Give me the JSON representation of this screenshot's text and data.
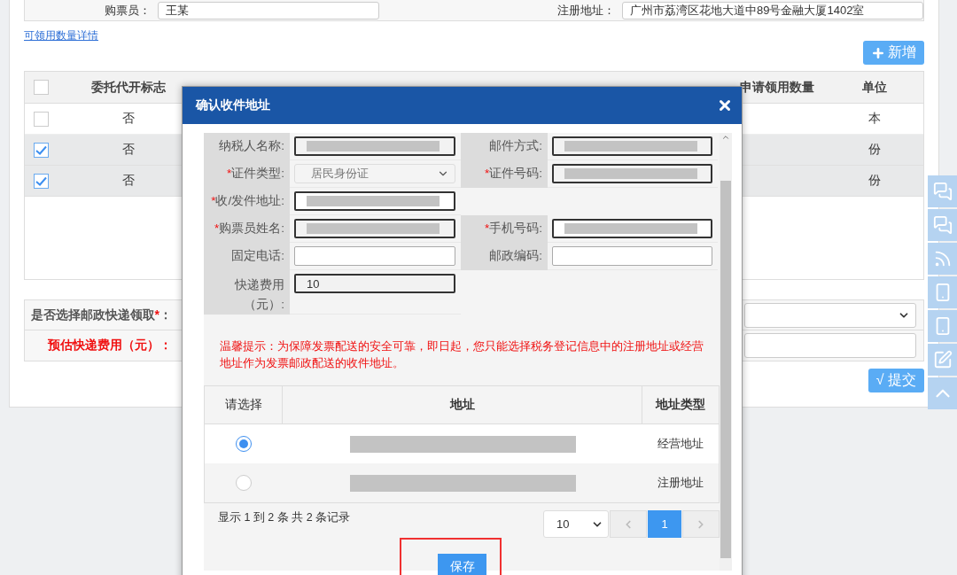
{
  "top_fields": [
    {
      "label": "购票员：",
      "value": "王某"
    },
    {
      "label": "注册地址：",
      "value": "广州市荔湾区花地大道中89号金融大厦1402室"
    }
  ],
  "detail_link": "可领用数量详情",
  "add_button": "新增",
  "table": {
    "header_checked": false,
    "columns": [
      "委托代开标志",
      "申请领用数量",
      "单位"
    ],
    "rows": [
      {
        "checked": false,
        "selected": false,
        "agent": "否",
        "unit": "本"
      },
      {
        "checked": true,
        "selected": true,
        "agent": "否",
        "unit": "份"
      },
      {
        "checked": true,
        "selected": true,
        "agent": "否",
        "unit": "份"
      }
    ]
  },
  "pickup_form": [
    {
      "label": "是否选择邮政快递领取",
      "asterisk": "*",
      "suffix": "：",
      "kind": "select",
      "highlight": false
    },
    {
      "label": "预估快递费用（元）",
      "suffix": "：",
      "kind": "input",
      "highlight": true
    }
  ],
  "submit_button": "√ 提交",
  "side_tools": [
    {
      "kind": "chat"
    },
    {
      "kind": "chat"
    },
    {
      "kind": "social"
    },
    {
      "kind": "phone"
    },
    {
      "kind": "phone"
    },
    {
      "kind": "edit"
    },
    {
      "kind": "top"
    }
  ],
  "dialog": {
    "title": "确认收件地址",
    "rows": [
      [
        {
          "label": "纳税人名称:",
          "kind": "input",
          "redacted": true,
          "editable": false,
          "multiline": false
        },
        {
          "label": "邮件方式:",
          "kind": "input",
          "redacted": true,
          "editable": false,
          "multiline": false
        }
      ],
      [
        {
          "asterisk": "*",
          "label": "证件类型:",
          "kind": "select",
          "value": "居民身份证",
          "multiline": false
        },
        {
          "asterisk": "*",
          "label": "证件号码:",
          "kind": "input",
          "redacted": true,
          "editable": false,
          "multiline": false
        }
      ],
      [
        {
          "asterisk": "*",
          "label": "收/发件地址:",
          "kind": "input",
          "redacted": true,
          "editable": true,
          "multiline": false
        }
      ],
      [
        {
          "asterisk": "*",
          "label": "购票员姓名:",
          "kind": "input",
          "redacted": true,
          "editable": false,
          "multiline": false
        },
        {
          "asterisk": "*",
          "label": "手机号码:",
          "kind": "input",
          "redacted": true,
          "editable": true,
          "multiline": false
        }
      ],
      [
        {
          "label": "固定电话:",
          "kind": "input",
          "redacted": false,
          "editable": true,
          "multiline": false
        },
        {
          "label": "邮政编码:",
          "kind": "input",
          "redacted": false,
          "editable": true,
          "multiline": false
        }
      ],
      [
        {
          "label": "快递费用（元）:",
          "kind": "input",
          "value": "10",
          "redacted": false,
          "editable": false,
          "multiline": true
        }
      ]
    ],
    "notice": "温馨提示：为保障发票配送的安全可靠，即日起，您只能选择税务登记信息中的注册地址或经营地址作为发票邮政配送的收件地址。",
    "address_table": {
      "columns": [
        "请选择",
        "地址",
        "地址类型"
      ],
      "rows": [
        {
          "selected": true,
          "redacted": true,
          "type": "经营地址"
        },
        {
          "selected": false,
          "redacted": true,
          "type": "注册地址"
        }
      ]
    },
    "record_info": "显示 1 到 2 条 共 2 条记录",
    "page_size": "10",
    "pages": [
      {
        "label": "1",
        "selected": true
      }
    ],
    "save_button": "保存",
    "save_highlighted": true
  }
}
